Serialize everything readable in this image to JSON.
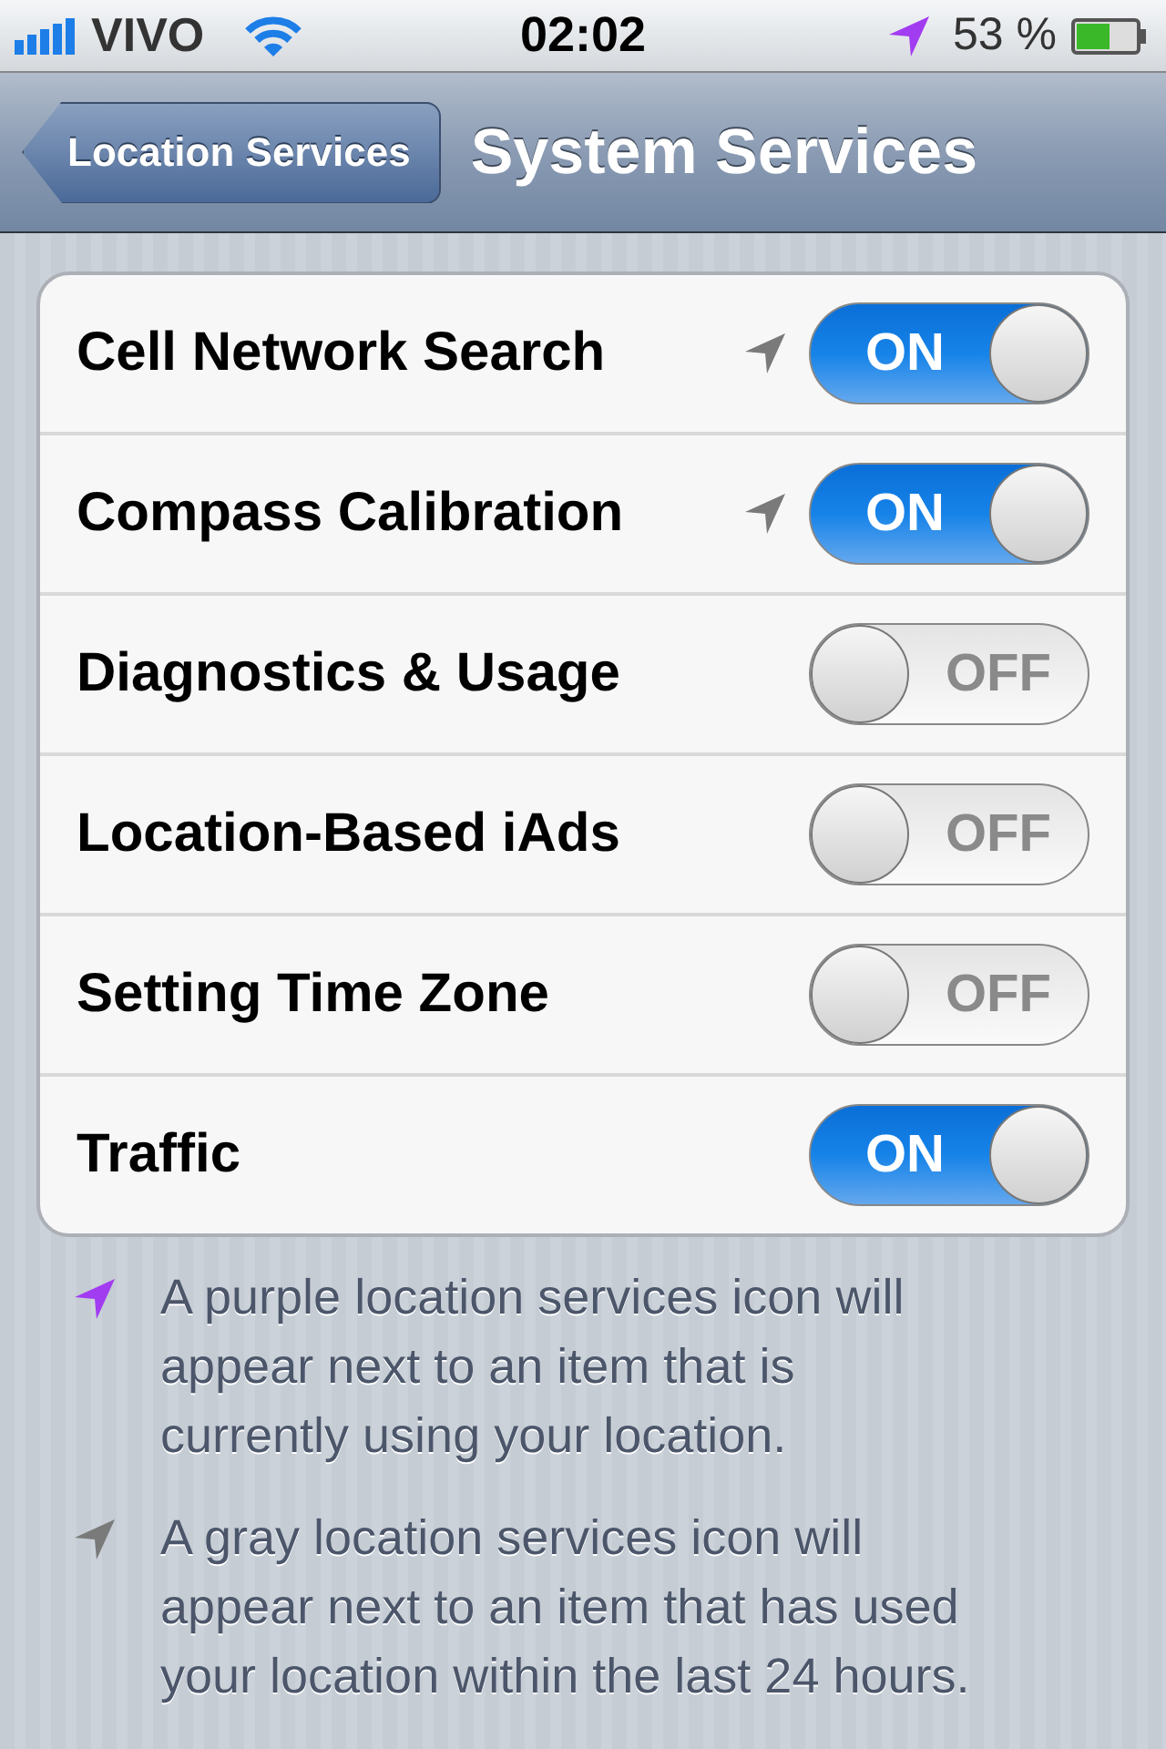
{
  "status_bar": {
    "carrier": "VIVO",
    "time": "02:02",
    "battery": "53 %"
  },
  "nav": {
    "back": "Location Services",
    "title": "System Services"
  },
  "rows": [
    {
      "label": "Cell Network Search",
      "recently_used": true,
      "on": true,
      "switch_label": "ON"
    },
    {
      "label": "Compass Calibration",
      "recently_used": true,
      "on": true,
      "switch_label": "ON"
    },
    {
      "label": "Diagnostics & Usage",
      "recently_used": false,
      "on": false,
      "switch_label": "OFF"
    },
    {
      "label": "Location-Based iAds",
      "recently_used": false,
      "on": false,
      "switch_label": "OFF"
    },
    {
      "label": "Setting Time Zone",
      "recently_used": false,
      "on": false,
      "switch_label": "OFF"
    },
    {
      "label": "Traffic",
      "recently_used": false,
      "on": true,
      "switch_label": "ON"
    }
  ],
  "notes": [
    {
      "kind": "active",
      "text": "A purple location services icon will appear next to an item that is currently using your location."
    },
    {
      "kind": "recent",
      "text": "A gray location services icon will appear next to an item that has used your location within the last 24 hours."
    }
  ]
}
